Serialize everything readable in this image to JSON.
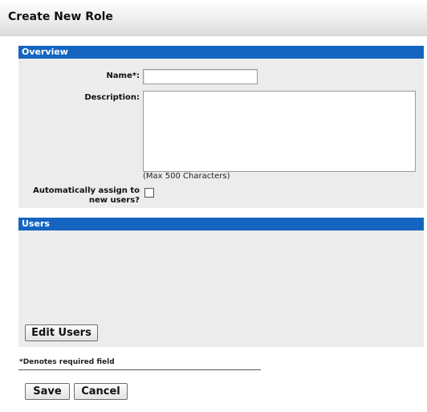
{
  "header": {
    "title": "Create New Role"
  },
  "overview": {
    "section_title": "Overview",
    "name_label": "Name*:",
    "name_value": "",
    "description_label": "Description:",
    "description_value": "",
    "description_hint": "(Max 500 Characters)",
    "auto_assign_label_line1": "Automatically assign to",
    "auto_assign_label_line2": "new users?",
    "auto_assign_checked": false
  },
  "users": {
    "section_title": "Users",
    "edit_users_label": "Edit Users"
  },
  "footer": {
    "required_note": "*Denotes required field",
    "save_label": "Save",
    "cancel_label": "Cancel"
  },
  "colors": {
    "section_header": "#1565c0",
    "panel_background": "#ececec"
  }
}
